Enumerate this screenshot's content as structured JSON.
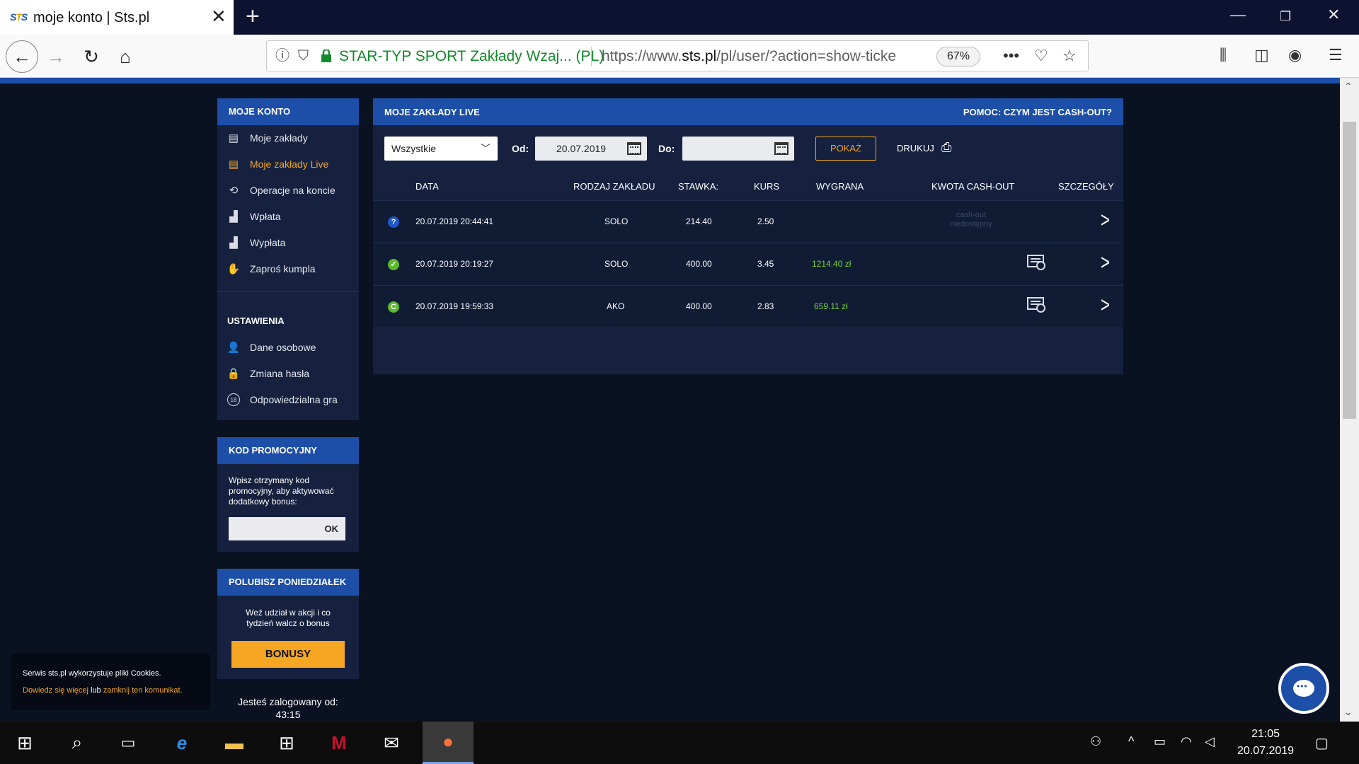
{
  "browser": {
    "tab_title": "moje konto | Sts.pl",
    "url_org": "STAR-TYP SPORT Zakłady Wzaj...  (PL)",
    "url_prefix": "https://www.",
    "url_domain": "sts.pl",
    "url_path": "/pl/user/?action=show-ticke",
    "zoom": "67%"
  },
  "sidebar": {
    "account_header": "MOJE KONTO",
    "account_items": [
      {
        "label": "Moje zakłady",
        "icon": "list-icon"
      },
      {
        "label": "Moje zakłady Live",
        "icon": "list-icon"
      },
      {
        "label": "Operacje na koncie",
        "icon": "exchange-icon"
      },
      {
        "label": "Wpłata",
        "icon": "deposit-icon"
      },
      {
        "label": "Wypłata",
        "icon": "withdraw-icon"
      },
      {
        "label": "Zaproś kumpla",
        "icon": "handshake-icon"
      }
    ],
    "settings_label": "USTAWIENIA",
    "settings_items": [
      {
        "label": "Dane osobowe",
        "icon": "user-icon"
      },
      {
        "label": "Zmiana hasła",
        "icon": "lock-icon"
      },
      {
        "label": "Odpowiedzialna gra",
        "icon": "age-18-icon"
      }
    ],
    "promo": {
      "header": "KOD PROMOCYJNY",
      "text": "Wpisz otrzymany kod promocyjny, aby aktywować dodatkowy bonus:",
      "input_value": "",
      "ok_label": "OK"
    },
    "monday": {
      "header": "POLUBISZ PONIEDZIAŁEK",
      "text": "Weź udział w akcji i co tydzień walcz o bonus",
      "button_label": "BONUSY"
    },
    "logged_in_label": "Jesteś zalogowany od:",
    "logged_in_time": "43:15"
  },
  "main": {
    "title": "MOJE ZAKŁADY LIVE",
    "help_link": "POMOC: CZYM JEST CASH-OUT?",
    "filter": {
      "type_selected": "Wszystkie",
      "from_label": "Od:",
      "from_value": "20.07.2019",
      "to_label": "Do:",
      "to_value": "",
      "show_label": "POKAŻ",
      "print_label": "DRUKUJ"
    },
    "columns": [
      "DATA",
      "RODZAJ ZAKŁADU",
      "STAWKA:",
      "KURS",
      "WYGRANA",
      "KWOTA CASH-OUT",
      "SZCZEGÓŁY"
    ],
    "rows": [
      {
        "status": "?",
        "status_color": "#1d57c6",
        "date": "20.07.2019 20:44:41",
        "type": "SOLO",
        "stake": "214.40",
        "odds": "2.50",
        "win": "",
        "cashout_line1": "cash-out",
        "cashout_line2": "niedostępny"
      },
      {
        "status": "✓",
        "status_color": "#5cb82e",
        "date": "20.07.2019 20:19:27",
        "type": "SOLO",
        "stake": "400.00",
        "odds": "3.45",
        "win": "1214.40 zł",
        "cashout_line1": "",
        "cashout_line2": ""
      },
      {
        "status": "C",
        "status_color": "#5cb82e",
        "date": "20.07.2019 19:59:33",
        "type": "AKO",
        "stake": "400.00",
        "odds": "2.83",
        "win": "659.11 zł",
        "cashout_line1": "",
        "cashout_line2": ""
      }
    ]
  },
  "cookie": {
    "line1": "Serwis sts.pl wykorzystuje pliki Cookies.",
    "link1": "Dowiedz się więcej",
    "mid": " lub ",
    "link2": "zamknij ten komunikat."
  },
  "taskbar": {
    "time": "21:05",
    "date": "20.07.2019"
  },
  "colors": {
    "brand_blue": "#1d4ea8",
    "accent_orange": "#f5a623",
    "win_green": "#7bd13d",
    "panel_bg": "#15213e"
  }
}
